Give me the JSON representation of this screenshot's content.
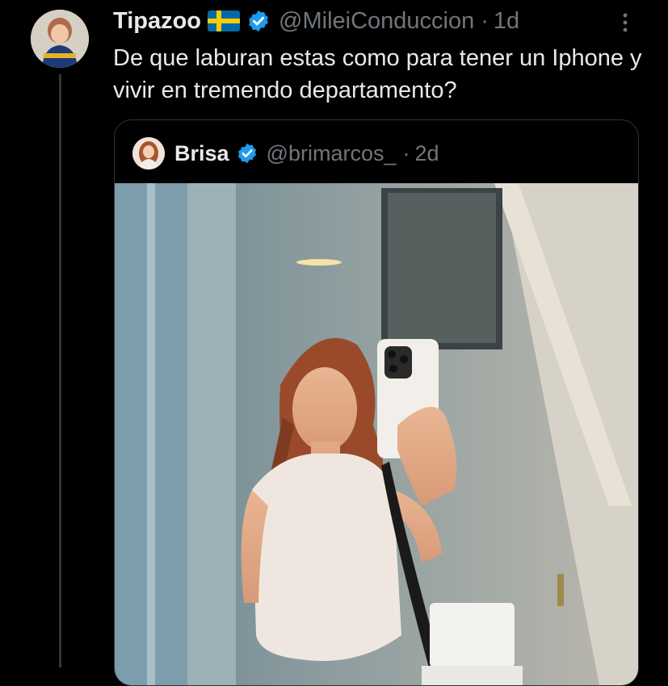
{
  "tweet": {
    "display_name": "Tipazoo",
    "handle": "@MileiConduccion",
    "separator": "·",
    "time": "1d",
    "text": "De que laburan estas como para tener un Iphone y vivir en tremendo departamento?",
    "flag_icon": "sweden-flag-icon",
    "verified_icon": "verified-badge-icon",
    "more_icon": "more-vertical-icon"
  },
  "quoted_tweet": {
    "display_name": "Brisa",
    "handle": "@brimarcos_",
    "separator": "·",
    "time": "2d",
    "verified_icon": "verified-badge-icon",
    "media_icon": "mirror-selfie-photo"
  },
  "colors": {
    "background": "#000000",
    "primary_text": "#e7e9ea",
    "secondary_text": "#71767b",
    "border": "#2f3336",
    "verified_blue": "#1d9bf0"
  }
}
